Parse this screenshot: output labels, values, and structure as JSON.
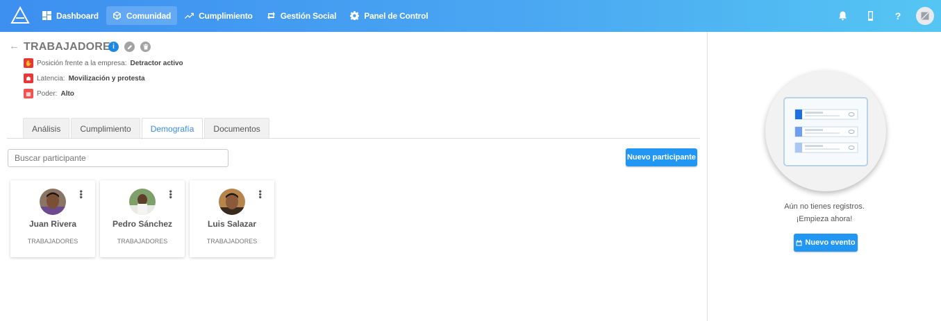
{
  "nav": {
    "items": [
      {
        "label": "Dashboard",
        "icon": "dashboard-icon"
      },
      {
        "label": "Comunidad",
        "icon": "cube-icon",
        "active": true
      },
      {
        "label": "Cumplimiento",
        "icon": "trend-icon"
      },
      {
        "label": "Gestión Social",
        "icon": "swap-icon"
      },
      {
        "label": "Panel de Control",
        "icon": "gear-icon"
      }
    ],
    "help_label": "?"
  },
  "group": {
    "title": "TRABAJADORES",
    "attributes": [
      {
        "label": "Posición frente a la empresa:",
        "value": "Detractor activo",
        "icon": "hand-icon"
      },
      {
        "label": "Latencia:",
        "value": "Movilización y protesta",
        "icon": "people-icon"
      },
      {
        "label": "Poder:",
        "value": "Alto",
        "icon": "power-icon"
      }
    ]
  },
  "tabs": [
    {
      "label": "Análisis"
    },
    {
      "label": "Cumplimiento"
    },
    {
      "label": "Demografía",
      "active": true
    },
    {
      "label": "Documentos"
    }
  ],
  "search": {
    "placeholder": "Buscar participante"
  },
  "buttons": {
    "new_participant": "Nuevo participante",
    "new_event": "Nuevo evento"
  },
  "participants": [
    {
      "name": "Juan Rivera",
      "role": "TRABAJADORES"
    },
    {
      "name": "Pedro Sánchez",
      "role": "TRABAJADORES"
    },
    {
      "name": "Luis Salazar",
      "role": "TRABAJADORES"
    }
  ],
  "empty_state": {
    "line1": "Aún no tienes registros.",
    "line2": "¡Empieza ahora!"
  },
  "colors": {
    "primary": "#2196f3",
    "topbar_start": "#3d8ff0",
    "topbar_end": "#55c6f3",
    "danger": "#e53935"
  }
}
